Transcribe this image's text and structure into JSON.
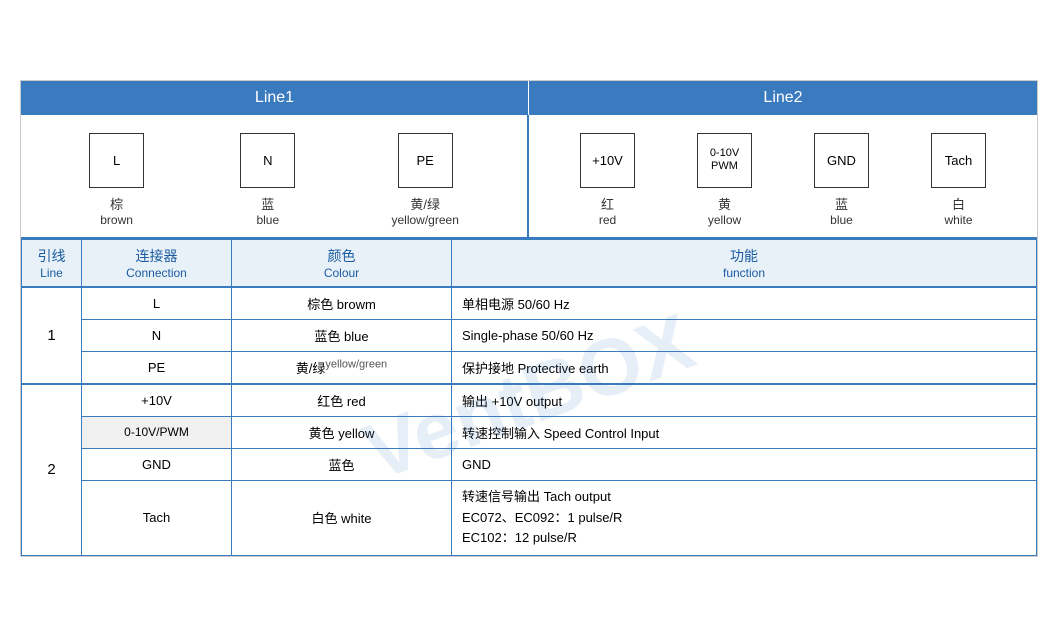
{
  "header": {
    "line1_label": "Line1",
    "line2_label": "Line2"
  },
  "diagram": {
    "line1_connectors": [
      {
        "id": "L",
        "cn": "棕",
        "en": "brown"
      },
      {
        "id": "N",
        "cn": "蓝",
        "en": "blue"
      },
      {
        "id": "PE",
        "cn": "黄/绿",
        "en": "yellow/green"
      }
    ],
    "line2_connectors": [
      {
        "id": "+10V",
        "cn": "红",
        "en": "red"
      },
      {
        "id": "0-10V\nPWM",
        "cn": "黄",
        "en": "yellow"
      },
      {
        "id": "GND",
        "cn": "蓝",
        "en": "blue"
      },
      {
        "id": "Tach",
        "cn": "白",
        "en": "white"
      }
    ]
  },
  "table": {
    "headers": {
      "line_cn": "引线",
      "line_en": "Line",
      "conn_cn": "连接器",
      "conn_en": "Connection",
      "colour_cn": "颜色",
      "colour_en": "Colour",
      "func_cn": "功能",
      "func_en": "function"
    },
    "rows": [
      {
        "line": "1",
        "rowspan": 3,
        "entries": [
          {
            "conn": "L",
            "colour_cn": "棕色",
            "colour_en": "browm",
            "func": "单相电源 50/60 Hz"
          },
          {
            "conn": "N",
            "colour_cn": "蓝色",
            "colour_en": "blue",
            "func": "Single-phase 50/60 Hz"
          },
          {
            "conn": "PE",
            "colour_cn": "黄/绿",
            "colour_en": "yellow/green",
            "func": "保护接地 Protective earth"
          }
        ]
      },
      {
        "line": "2",
        "rowspan": 4,
        "entries": [
          {
            "conn": "+10V",
            "colour_cn": "红色",
            "colour_en": "red",
            "func": "输出 +10V output"
          },
          {
            "conn": "0-10V/PWM",
            "colour_cn": "黄色",
            "colour_en": "yellow",
            "func": "转速控制输入 Speed Control Input"
          },
          {
            "conn": "GND",
            "colour_cn": "蓝色",
            "colour_en": "",
            "func": "GND"
          },
          {
            "conn": "Tach",
            "colour_cn": "白色",
            "colour_en": "white",
            "func": "转速信号输出 Tach output\nEC072、EC092：1 pulse/R\nEC102：12 pulse/R"
          }
        ]
      }
    ]
  },
  "watermark": "VentBOX"
}
